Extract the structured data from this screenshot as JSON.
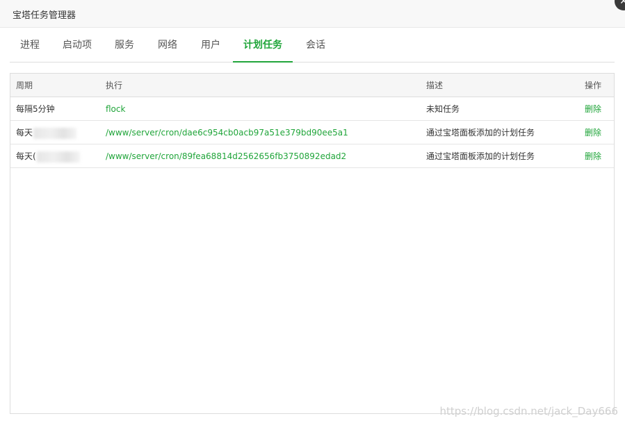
{
  "window": {
    "title": "宝塔任务管理器",
    "close_glyph": "✕"
  },
  "tabs": [
    {
      "label": "进程",
      "active": false
    },
    {
      "label": "启动项",
      "active": false
    },
    {
      "label": "服务",
      "active": false
    },
    {
      "label": "网络",
      "active": false
    },
    {
      "label": "用户",
      "active": false
    },
    {
      "label": "计划任务",
      "active": true
    },
    {
      "label": "会话",
      "active": false
    }
  ],
  "table": {
    "headers": [
      "周期",
      "执行",
      "描述",
      "操作"
    ],
    "rows": [
      {
        "period": "每隔5分钟",
        "exec": "flock",
        "desc": "未知任务",
        "action": "删除"
      },
      {
        "period": "每天",
        "exec": "/www/server/cron/dae6c954cb0acb97a51e379bd90ee5a1",
        "desc": "通过宝塔面板添加的计划任务",
        "action": "删除"
      },
      {
        "period": "每天(",
        "exec": "/www/server/cron/89fea68814d2562656fb3750892edad2",
        "desc": "通过宝塔面板添加的计划任务",
        "action": "删除"
      }
    ]
  },
  "watermark": "https://blog.csdn.net/jack_Day666",
  "colors": {
    "accent": "#20a53a",
    "border": "#dddddd",
    "header_bg": "#f6f6f6"
  }
}
